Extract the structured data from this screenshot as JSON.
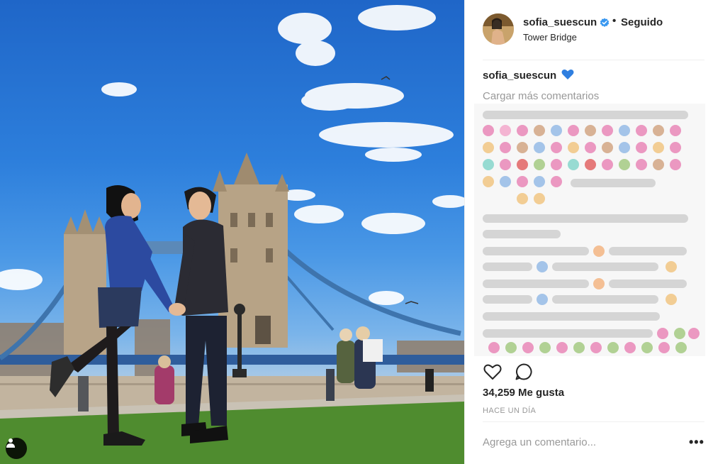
{
  "post": {
    "username": "sofia_suescun",
    "follow_status": "Seguido",
    "separator": "•",
    "location": "Tower Bridge",
    "caption_user": "sofia_suescun",
    "caption_emoji": "blue-heart",
    "load_more": "Cargar más comentarios",
    "likes": "34,259 Me gusta",
    "time_ago": "HACE UN DÍA",
    "comment_placeholder": "Agrega un comentario...",
    "more_options": "•••"
  },
  "icons": {
    "verified": "verified-badge-icon",
    "like": "heart-outline-icon",
    "comment": "speech-bubble-icon",
    "tag": "user-tag-icon",
    "options": "ellipsis-icon"
  },
  "colors": {
    "verified_blue": "#3897f0",
    "text": "#262626",
    "muted": "#999999",
    "border": "#efefef",
    "sky": "#2d7fdc",
    "grass": "#4f8c2f"
  }
}
